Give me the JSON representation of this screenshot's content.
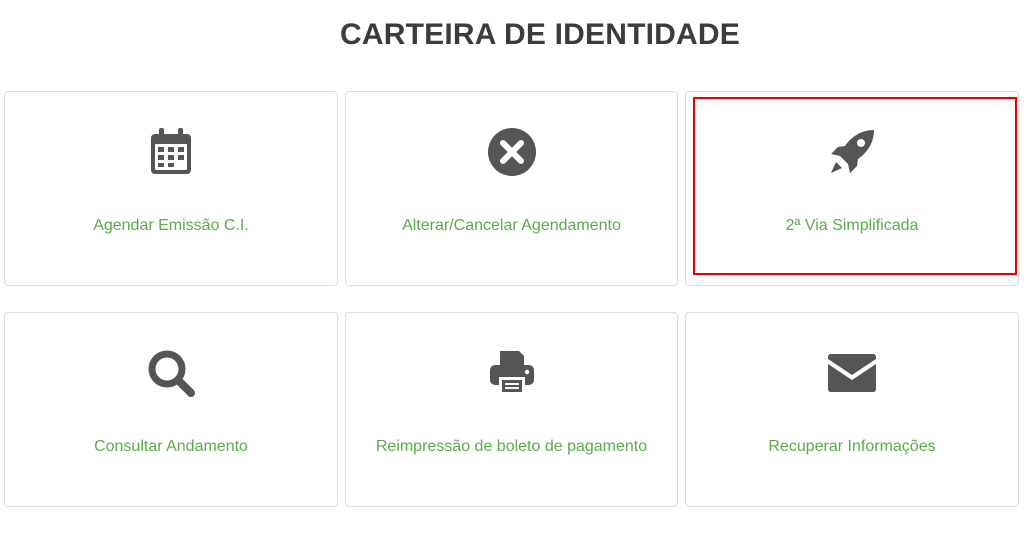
{
  "page": {
    "title": "CARTEIRA DE IDENTIDADE"
  },
  "colors": {
    "title": "#3c3c3c",
    "label": "#5aab4a",
    "icon": "#555555",
    "card_border": "#dcdcdc",
    "highlight": "#e60000"
  },
  "cards": [
    {
      "label": "Agendar Emissão C.I.",
      "icon": "calendar-icon"
    },
    {
      "label": "Alterar/Cancelar Agendamento",
      "icon": "cancel-circle-icon"
    },
    {
      "label": "2ª Via Simplificada",
      "icon": "rocket-icon",
      "highlighted": true
    },
    {
      "label": "Consultar Andamento",
      "icon": "search-icon"
    },
    {
      "label": "Reimpressão de boleto de pagamento",
      "icon": "printer-icon"
    },
    {
      "label": "Recuperar Informações",
      "icon": "envelope-icon"
    }
  ]
}
